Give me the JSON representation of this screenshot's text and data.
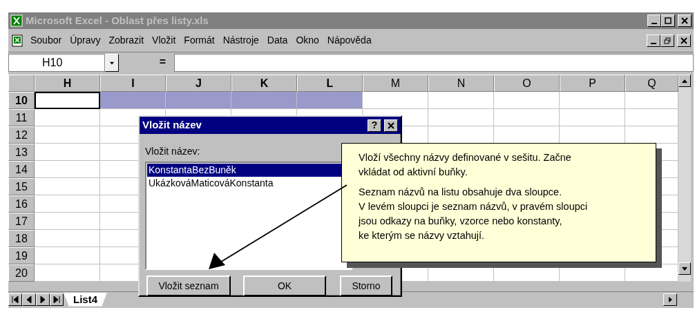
{
  "window": {
    "title": "Microsoft Excel - Oblast přes listy.xls"
  },
  "menu": [
    {
      "label": "Soubor"
    },
    {
      "label": "Úpravy"
    },
    {
      "label": "Zobrazit"
    },
    {
      "label": "Vložit"
    },
    {
      "label": "Formát"
    },
    {
      "label": "Nástroje"
    },
    {
      "label": "Data"
    },
    {
      "label": "Okno"
    },
    {
      "label": "Nápověda"
    }
  ],
  "formula_bar": {
    "name_box": "H10",
    "equals": "="
  },
  "columns": [
    {
      "label": "H",
      "selected": true,
      "active": true
    },
    {
      "label": "I",
      "selected": true,
      "active": false
    },
    {
      "label": "J",
      "selected": true,
      "active": false
    },
    {
      "label": "K",
      "selected": true,
      "active": false
    },
    {
      "label": "L",
      "selected": true,
      "active": false
    },
    {
      "label": "M",
      "selected": false,
      "active": false
    },
    {
      "label": "N",
      "selected": false,
      "active": false
    },
    {
      "label": "O",
      "selected": false,
      "active": false
    },
    {
      "label": "P",
      "selected": false,
      "active": false
    },
    {
      "label": "Q",
      "selected": false,
      "active": false
    }
  ],
  "rows": [
    {
      "label": "10",
      "selected": true
    },
    {
      "label": "11",
      "selected": false
    },
    {
      "label": "12",
      "selected": false
    },
    {
      "label": "13",
      "selected": false
    },
    {
      "label": "14",
      "selected": false
    },
    {
      "label": "15",
      "selected": false
    },
    {
      "label": "16",
      "selected": false
    },
    {
      "label": "17",
      "selected": false
    },
    {
      "label": "18",
      "selected": false
    },
    {
      "label": "19",
      "selected": false
    },
    {
      "label": "20",
      "selected": false
    }
  ],
  "sheet_tabs": [
    {
      "label": "List4",
      "selected": true
    }
  ],
  "dialog": {
    "title": "Vložit název",
    "help": "?",
    "label": "Vložit název:",
    "names": [
      {
        "label": "KonstantaBezBuněk",
        "selected": true
      },
      {
        "label": "UkázkováMaticováKonstanta",
        "selected": false
      }
    ],
    "buttons": [
      {
        "label": "Vložit seznam"
      },
      {
        "label": "OK"
      },
      {
        "label": "Storno"
      }
    ]
  },
  "callout": {
    "paragraphs": [
      [
        "Vloží všechny názvy definované v sešitu. Začne",
        "vkládat od aktivní buňky."
      ],
      [
        "Seznam názvů na listu obsahuje dva sloupce.",
        "V levém sloupci je seznam názvů, v pravém sloupci",
        "jsou odkazy na buňky, vzorce nebo konstanty,",
        "ke kterým se názvy vztahují."
      ]
    ]
  }
}
